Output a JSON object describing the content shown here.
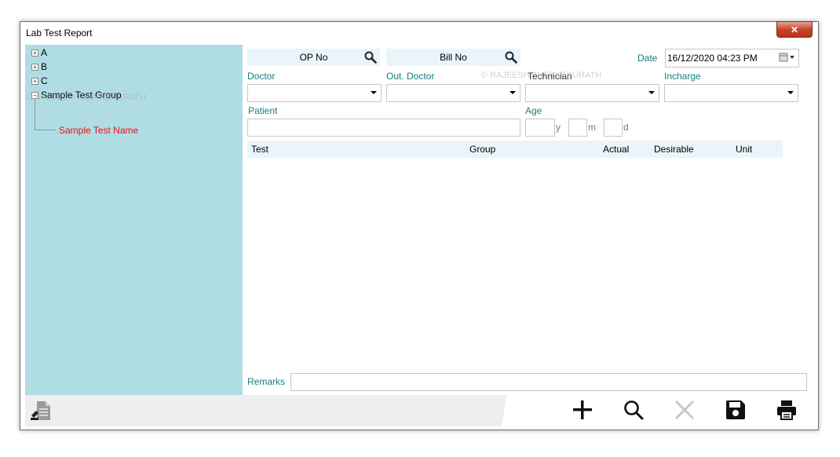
{
  "window": {
    "title": "Lab Test Report",
    "close_label": "✕"
  },
  "watermark": "© RAJEESH THEKKEPURATH",
  "tree": {
    "items": [
      {
        "label": "A",
        "expander": "+"
      },
      {
        "label": "B",
        "expander": "+"
      },
      {
        "label": "C",
        "expander": "+"
      },
      {
        "label": "Sample Test Group",
        "expander": "−"
      }
    ],
    "child": {
      "label": "Sample Test Name"
    }
  },
  "form": {
    "op_no_label": "OP No",
    "bill_no_label": "Bill No",
    "date_label": "Date",
    "date_value": "16/12/2020 04:23 PM",
    "doctor_label": "Doctor",
    "out_doctor_label": "Out. Doctor",
    "technician_label": "Technician",
    "incharge_label": "Incharge",
    "patient_label": "Patient",
    "age_label": "Age",
    "age_units": {
      "years": "y",
      "months": "m",
      "days": "d"
    },
    "remarks_label": "Remarks"
  },
  "grid": {
    "columns": [
      "Test",
      "Group",
      "Actual",
      "Desirable",
      "Unit"
    ]
  },
  "toolbar": {
    "buttons": [
      "add-icon",
      "search-icon",
      "delete-icon",
      "save-icon",
      "print-icon"
    ]
  },
  "colors": {
    "sidebar": "#b0dde3",
    "label_teal": "#17807e",
    "child_red": "#e0141e",
    "header_bg": "#eaf4fb"
  }
}
